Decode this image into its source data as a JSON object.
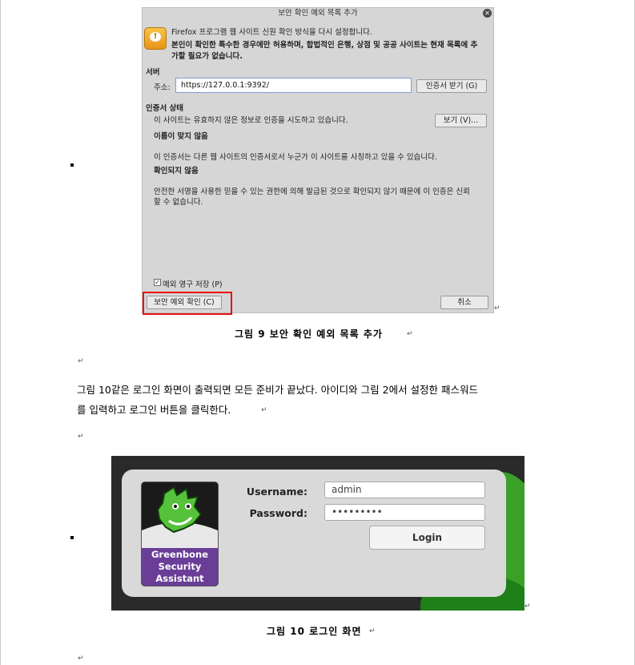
{
  "dialog": {
    "title": "보안 확인 예외 목록 추가",
    "close_glyph": "✕",
    "warn_glyph": "!",
    "notice": "Firefox 프로그램 웹 사이트 신원 확인 방식을 다시 설정합니다.",
    "warning_line1": "본인이 확인한 특수한 경우에만 허용하며, 합법적인 은행, 상점 및 공공 사이트는 현재 목록에 추",
    "warning_line2": "가할 필요가 없습니다.",
    "server_section": "서버",
    "address_label": "주소:",
    "address_value": "https://127.0.0.1:9392/",
    "get_cert_button": "인증서 받기 (G)",
    "cert_status_section": "인증서 상태",
    "cert_status_text": "이 사이트는 유효하지 않은 정보로 인증을 시도하고 있습니다.",
    "view_button": "보기 (V)...",
    "wrong_site_heading": "이름이 맞지 않음",
    "wrong_site_text": "이 인증서는 다른 웹 사이트의 인증서로서 누군가 이 사이트를 사칭하고 있을 수 있습니다.",
    "unknown_heading": "확인되지 않음",
    "unknown_line1": "안전한 서명을 사용한 믿을 수 있는 권한에 의해 발급된 것으로 확인되지 않기 때문에 이 인증은 신뢰",
    "unknown_line2": "할 수 없습니다.",
    "permanent_checkbox_label": "예외 영구 저장 (P)",
    "permanent_checked": true,
    "check_glyph": "✓",
    "confirm_button": "보안 예외 확인 (C)",
    "cancel_button": "취소"
  },
  "caption1": "그림 9 보안 확인 예외 목록 추가",
  "paragraph_line1": "그림 10같은 로그인 화면이 출력되면 모든 준비가 끝났다. 아이디와 그림 2에서 설정한 패스워드",
  "paragraph_line2": "를 입력하고 로그인 버튼을 클릭한다.",
  "paragraph_mark": "↵",
  "login": {
    "logo_line1": "Greenbone",
    "logo_line2": "Security",
    "logo_line3": "Assistant",
    "username_label": "Username:",
    "username_value": "admin",
    "password_label": "Password:",
    "password_value": "•••••••••",
    "login_button": "Login"
  },
  "caption2": "그림 10 로그인 화면",
  "colors": {
    "highlight_box": "#e8100f",
    "dialog_bg": "#d6d6d6",
    "greenbone_green": "#3aa028",
    "greenbone_purple": "#6a3d97"
  }
}
